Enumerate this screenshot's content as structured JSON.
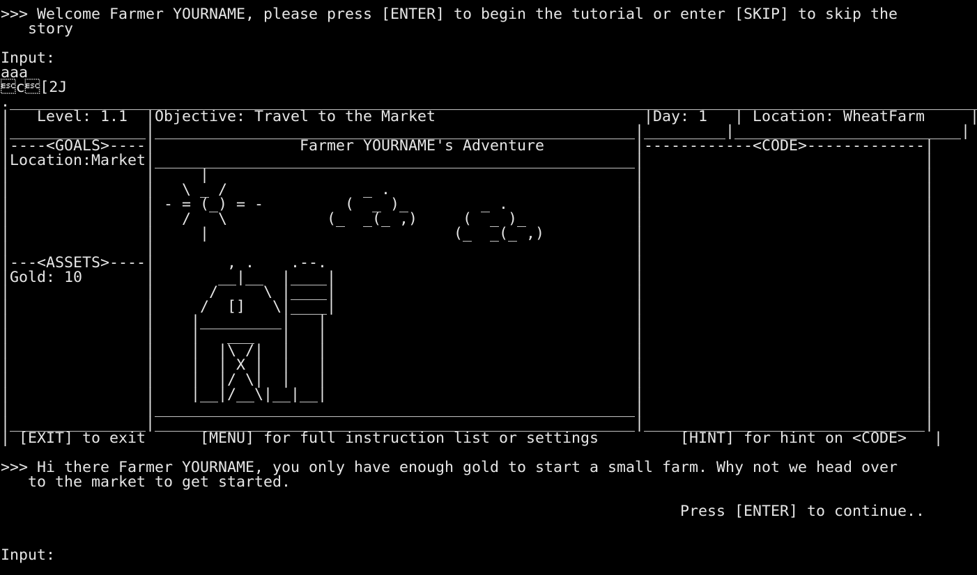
{
  "intro": {
    "welcome_line1": ">>> Welcome Farmer YOURNAME, please press [ENTER] to begin the tutorial or enter [SKIP] to skip the",
    "welcome_line2": "   story",
    "input_label": "Input:",
    "input_value": "aaa",
    "escape_line": "\u001bc\u001b[2J"
  },
  "frame": {
    "rows": [
      ".____________________________________________________________________________________________________________.",
      "|   Level: 1.1  |Objective: Travel to the Market                       |Day: 1   | Location: WheatFarm     |",
      "|_______________|_____________________________________________________|_________|_________________________|",
      "|----<GOALS>----|                Farmer YOURNAME's Adventure          |------------<CODE>-------------|",
      "|Location:Market|_____________________________________________________|                               |",
      "|               |     |                                               |                               |",
      "|               |   \\ _ /               _ .                           |                               |",
      "|               | - = (_) = -         (  _ )_        _ .              |                               |",
      "|               |   /   \\           (_  _(_ ,)     (  _ )_            |                               |",
      "|               |     |                           (_  _(_ ,)          |                               |",
      "|               |                                                     |                               |",
      "|---<ASSETS>----|        , .    .--.                                  |                               |",
      "|Gold: 10       |       __|__  |____|                                 |                               |",
      "|               |      /     \\ |____|                                 |                               |",
      "|               |     /  []   \\|____|                                 |                               |",
      "|               |    |_________|   |                                  |                               |",
      "|               |    |   ___   |   |                                  |                               |",
      "|               |    |  |\\ /|  |   |                                  |                               |",
      "|               |    |  | X |  |   |                                  |                               |",
      "|               |    |  |/ \\|  |   |                                  |                               |",
      "|               |    |__|/__\\|__|__|                                  |                               |",
      "|               |_____________________________________________________|                               |",
      "|_______________|_____________________________________________________|_______________________________|",
      "| [EXIT] to exit      [MENU] for full instruction list or settings         [HINT] for hint on <CODE>   |"
    ]
  },
  "dialog": {
    "line1": ">>> Hi there Farmer YOURNAME, you only have enough gold to start a small farm. Why not we head over",
    "line2": "   to the market to get started.",
    "continue_prompt": "                                                                           Press [ENTER] to continue..",
    "input_label": "Input:"
  },
  "colors": {
    "background": "#000000",
    "foreground": "#e6e6e6"
  }
}
